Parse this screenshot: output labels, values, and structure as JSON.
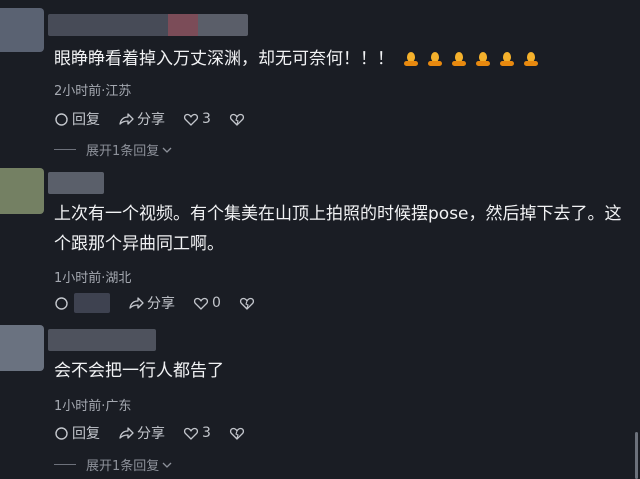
{
  "comments": [
    {
      "text": "眼睁睁看着掉入万丈深渊，却无可奈何！！！",
      "meta": "2小时前·江苏",
      "reply_label": "回复",
      "share_label": "分享",
      "like_count": "3",
      "expand_label": "展开1条回复",
      "avatar_color": "#5a6272"
    },
    {
      "text": "上次有一个视频。有个集美在山顶上拍照的时候摆pose，然后掉下去了。这个跟那个异曲同工啊。",
      "meta": "1小时前·湖北",
      "share_label": "分享",
      "like_count": "0",
      "avatar_color": "#748063"
    },
    {
      "text": "会不会把一行人都告了",
      "meta": "1小时前·广东",
      "reply_label": "回复",
      "share_label": "分享",
      "like_count": "3",
      "expand_label": "展开1条回复",
      "avatar_color": "#6a7280"
    }
  ],
  "emoji_icons": [
    "bell-icon",
    "bell-icon",
    "bell-icon",
    "bell-icon",
    "bell-icon",
    "bell-icon"
  ]
}
